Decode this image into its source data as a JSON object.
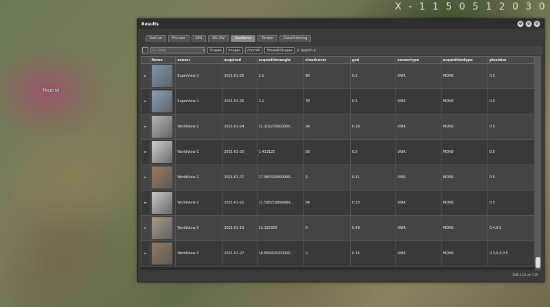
{
  "map": {
    "city_label": "Madrid",
    "top_text": "X - 1 1 5 0 5 1 2 0 3 0"
  },
  "window": {
    "title": "Results",
    "controls": [
      "o",
      "o",
      "o"
    ]
  },
  "tabs": [
    "SatCon",
    "Frontex",
    "SEA",
    "DG-SW",
    "GeoServe",
    "Terrain",
    "DataOrdering"
  ],
  "active_tab": "GeoServe",
  "toolbar": {
    "search_placeholder": "Q- none",
    "shapes_label": "Shapes",
    "images_label": "Images",
    "zoomto_label": "ZoomTo",
    "show_all_label": "ShowAllShapes",
    "search_label": "Search"
  },
  "grid": {
    "columns": [
      "",
      "Name",
      "sensor",
      "acquired",
      "acquisitionangle",
      "cloudcover",
      "gsd",
      "sensortype",
      "acquisitiontype",
      "pixelsize"
    ],
    "rows": [
      {
        "sensor": "SuperView-1",
        "acquired": "2021-01-25",
        "angle": "2.1",
        "cloud": "90",
        "gsd": "0.5",
        "stype": "VNIR",
        "atype": "MONO",
        "pixel": "0.5",
        "thumb_color": "#7f97ad"
      },
      {
        "sensor": "SuperView-1",
        "acquired": "2021-01-25",
        "angle": "2.1",
        "cloud": "78",
        "gsd": "0.5",
        "stype": "VNIR",
        "atype": "MONO",
        "pixel": "0.5",
        "thumb_color": "#8aa0b8"
      },
      {
        "sensor": "WorldView-1",
        "acquired": "2021-01-24",
        "angle": "21.202270000000...",
        "cloud": "34",
        "gsd": "0.36",
        "stype": "VNIR",
        "atype": "MONO",
        "pixel": "0.5",
        "thumb_color": "#b5b5b5"
      },
      {
        "sensor": "WorldView-1",
        "acquired": "2021-01-20",
        "angle": "1.413125",
        "cloud": "93",
        "gsd": "0.5",
        "stype": "VNIR",
        "atype": "MONO",
        "pixel": "0.5",
        "thumb_color": "#d0d0d0"
      },
      {
        "sensor": "WorldView-2",
        "acquired": "2021-01-27",
        "angle": "17.965329999999...",
        "cloud": "2",
        "gsd": "0.51",
        "stype": "VNIR",
        "atype": "MONO",
        "pixel": "0.5",
        "thumb_color": "#9a7a5c"
      },
      {
        "sensor": "WorldView-2",
        "acquired": "2021-01-22",
        "angle": "21.596719999999...",
        "cloud": "84",
        "gsd": "0.53",
        "stype": "VNIR",
        "atype": "MONO",
        "pixel": "0.5",
        "thumb_color": "#c8c8c8"
      },
      {
        "sensor": "WorldView-2",
        "acquired": "2021-01-19",
        "angle": "12.125359",
        "cloud": "0",
        "gsd": "0.48",
        "stype": "VNIR",
        "atype": "MONO",
        "pixel": "0.4,0.5",
        "thumb_color": "#a59a88"
      },
      {
        "sensor": "WorldView-3",
        "acquired": "2021-01-27",
        "angle": "18.689915000000...",
        "cloud": "0",
        "gsd": "0.34",
        "stype": "VNIR",
        "atype": "MONO",
        "pixel": "0.3,0.4,0.5",
        "thumb_color": "#8f7a60"
      }
    ]
  },
  "footer": {
    "paging": "108-115 of 115"
  }
}
